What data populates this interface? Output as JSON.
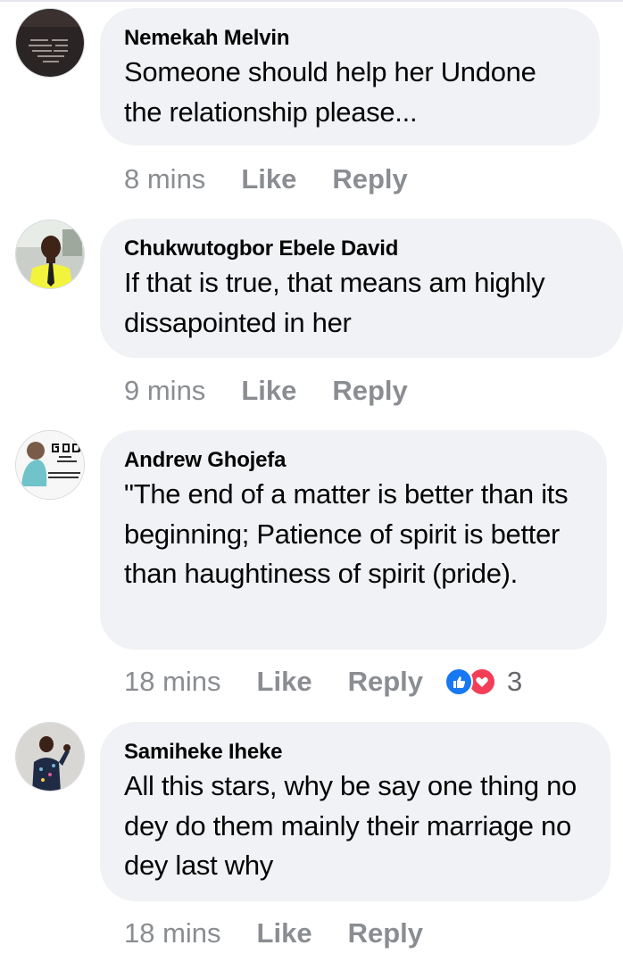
{
  "comments": [
    {
      "author": "Nemekah Melvin",
      "text": "Someone should help her Undone the relationship please...",
      "time": "8 mins",
      "like_label": "Like",
      "reply_label": "Reply",
      "avatar_icon": "dark-quote-avatar-icon"
    },
    {
      "author": "Chukwutogbor Ebele David",
      "text": "If that is true, that means am highly dissapointed in her",
      "time": "9 mins",
      "like_label": "Like",
      "reply_label": "Reply",
      "avatar_icon": "person-yellow-shirt-avatar-icon"
    },
    {
      "author": "Andrew Ghojefa",
      "text": "\"The end of a matter is better than its beginning; Patience of spirit is better than haughtiness of spirit (pride).",
      "time": "18 mins",
      "like_label": "Like",
      "reply_label": "Reply",
      "reaction_count": "3",
      "reactions": [
        "like",
        "love"
      ],
      "avatar_icon": "god-text-avatar-icon"
    },
    {
      "author": "Samiheke Iheke",
      "text": "All this stars, why be say one thing no dey do them mainly  their marriage no dey last why",
      "time": "18 mins",
      "like_label": "Like",
      "reply_label": "Reply",
      "avatar_icon": "child-avatar-icon"
    }
  ],
  "colors": {
    "bubble_bg": "#f0f2f5",
    "meta_text": "#8a8d91",
    "like_reaction": "#1877f2",
    "love_reaction": "#f33e58"
  }
}
